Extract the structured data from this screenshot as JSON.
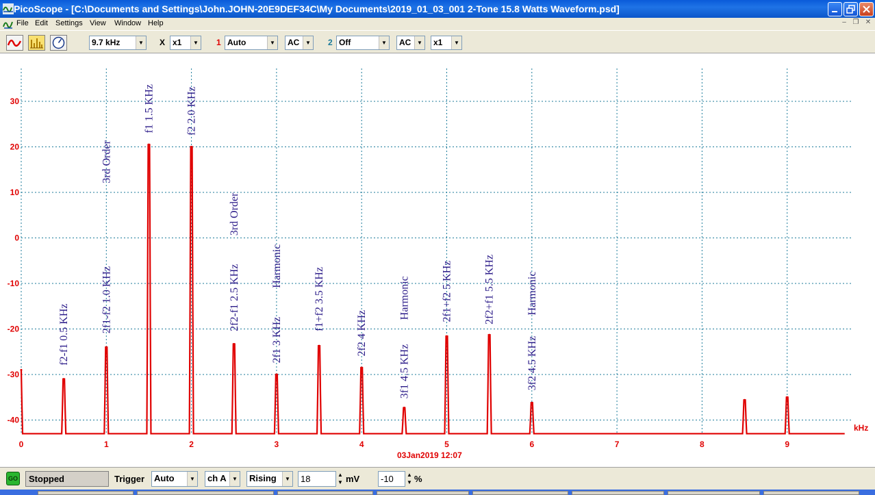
{
  "window": {
    "app_name": "PicoScope",
    "title": "PicoScope - [C:\\Documents and Settings\\John.JOHN-20E9DEF34C\\My Documents\\2019_01_03_001 2-Tone 15.8 Watts Waveform.psd]"
  },
  "menu": [
    "File",
    "Edit",
    "Settings",
    "View",
    "Window",
    "Help"
  ],
  "toolbar": {
    "buttons": [
      {
        "name": "scope-mode",
        "icon": "scope-wave-icon"
      },
      {
        "name": "spectrum-mode",
        "icon": "spectrum-bars-icon"
      },
      {
        "name": "meter-mode",
        "icon": "meter-dial-icon"
      }
    ],
    "span": "9.7 kHz",
    "x_label": "X",
    "x_mult": "x1",
    "ch1_label": "1",
    "ch1_range": "Auto",
    "ch1_coupling": "AC",
    "ch2_label": "2",
    "ch2_range": "Off",
    "ch2_coupling": "AC",
    "ch2_mult": "x1"
  },
  "colors": {
    "trace": "#e00000",
    "grid": "#1a7a9a",
    "annotation": "#2a1a88",
    "channel1": "#e00000",
    "channel2": "#1a7a9a"
  },
  "chart_data": {
    "type": "line",
    "xlabel": "kHz",
    "timestamp": "03Jan2019  12:07",
    "xlim": [
      0,
      9.7
    ],
    "ylim": [
      -43,
      36
    ],
    "xticks": [
      0,
      1,
      2,
      3,
      4,
      5,
      6,
      7,
      8,
      9
    ],
    "yticks": [
      30,
      20,
      10,
      0,
      -10,
      -20,
      -30,
      -40
    ],
    "noise_floor": -43,
    "grid": true,
    "peaks": [
      {
        "x": 0.0,
        "y": -29
      },
      {
        "x": 0.5,
        "y": -31
      },
      {
        "x": 1.0,
        "y": -24
      },
      {
        "x": 1.5,
        "y": 20.5
      },
      {
        "x": 2.0,
        "y": 20
      },
      {
        "x": 2.5,
        "y": -23.3
      },
      {
        "x": 3.0,
        "y": -30
      },
      {
        "x": 3.5,
        "y": -23.7
      },
      {
        "x": 4.0,
        "y": -28.5
      },
      {
        "x": 4.5,
        "y": -37.3
      },
      {
        "x": 5.0,
        "y": -21.6
      },
      {
        "x": 5.5,
        "y": -21.3
      },
      {
        "x": 6.0,
        "y": -36.2
      },
      {
        "x": 8.5,
        "y": -35.6
      },
      {
        "x": 9.0,
        "y": -35
      }
    ],
    "annotations": [
      {
        "text": "f2-f1 0.5 KHz",
        "x": 0.5,
        "y": -28
      },
      {
        "text": "3rd Order",
        "x": 1.0,
        "y": 12
      },
      {
        "text": "2f1-f2 1.0 KHz",
        "x": 1.0,
        "y": -21
      },
      {
        "text": "f1 1.5 KHz",
        "x": 1.5,
        "y": 23
      },
      {
        "text": "f2 2.0 KHz",
        "x": 2.0,
        "y": 22.5
      },
      {
        "text": "3rd Order",
        "x": 2.5,
        "y": 0.5
      },
      {
        "text": "2f2-f1 2.5 KHz",
        "x": 2.5,
        "y": -20.5
      },
      {
        "text": "Harmonic",
        "x": 3.0,
        "y": -11
      },
      {
        "text": "2f1 3 KHz",
        "x": 3.0,
        "y": -27.5
      },
      {
        "text": "f1+f2 3.5 KHz",
        "x": 3.5,
        "y": -20.5
      },
      {
        "text": "2f2 4 KHz",
        "x": 4.0,
        "y": -26
      },
      {
        "text": "Harmonic",
        "x": 4.5,
        "y": -18
      },
      {
        "text": "3f1 4.5 KHz",
        "x": 4.5,
        "y": -35.3
      },
      {
        "text": "2f1+f2 5 KHz",
        "x": 5.0,
        "y": -18.5
      },
      {
        "text": "2f2+f1 5.5 KHz",
        "x": 5.5,
        "y": -19
      },
      {
        "text": "Harmonic",
        "x": 6.0,
        "y": -17
      },
      {
        "text": "3f2 4.5 KHz",
        "x": 6.0,
        "y": -33.5
      }
    ]
  },
  "statusbar": {
    "go_label": "GO",
    "status": "Stopped",
    "trigger_label": "Trigger",
    "trigger_mode": "Auto",
    "trigger_channel": "ch A",
    "trigger_edge": "Rising",
    "trigger_level": "18",
    "trigger_level_unit": "mV",
    "pretrigger": "-10",
    "pretrigger_unit": "%"
  }
}
